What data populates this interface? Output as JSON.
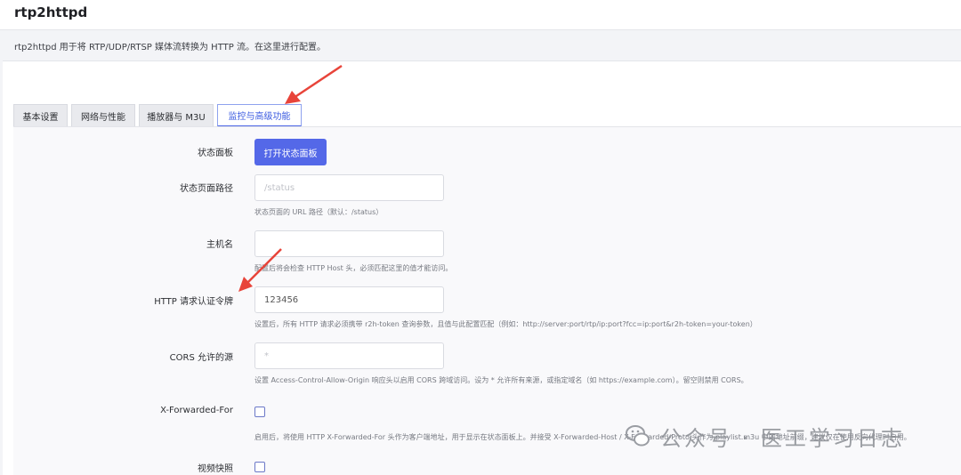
{
  "app": {
    "title": "rtp2httpd",
    "description": "rtp2httpd 用于将 RTP/UDP/RTSP 媒体流转换为 HTTP 流。在这里进行配置。"
  },
  "tabs": [
    {
      "label": "基本设置"
    },
    {
      "label": "网络与性能"
    },
    {
      "label": "播放器与 M3U"
    },
    {
      "label": "监控与高级功能",
      "active": true
    }
  ],
  "form": {
    "status_panel": {
      "label": "状态面板",
      "button": "打开状态面板"
    },
    "status_path": {
      "label": "状态页面路径",
      "placeholder": "/status",
      "help": "状态页面的 URL 路径（默认：/status）"
    },
    "hostname": {
      "label": "主机名",
      "value": "",
      "help": "配置后将会检查 HTTP Host 头，必须匹配这里的值才能访问。"
    },
    "token": {
      "label": "HTTP 请求认证令牌",
      "value": "123456",
      "help": "设置后，所有 HTTP 请求必须携带 r2h-token 查询参数，且值与此配置匹配（例如：http://server:port/rtp/ip:port?fcc=ip:port&r2h-token=your-token）"
    },
    "cors": {
      "label": "CORS 允许的源",
      "placeholder": "*",
      "help": "设置 Access-Control-Allow-Origin 响应头以启用 CORS 跨域访问。设为 * 允许所有来源，或指定域名（如 https://example.com）。留空则禁用 CORS。"
    },
    "xff": {
      "label": "X-Forwarded-For",
      "checked": false,
      "help": "启用后，将使用 HTTP X-Forwarded-For 头作为客户端地址，用于显示在状态面板上。并接受 X-Forwarded-Host / X-Forwarded-Proto 头作为 playlist.m3u 中的地址前缀，建议仅在使用反向代理时启用。"
    },
    "snapshot": {
      "label": "视频快照",
      "checked": false
    }
  },
  "watermark": {
    "text": "公众号 · 医工学习日志",
    "icon": "wechat-icon"
  },
  "colors": {
    "accent": "#5468e8",
    "arrow": "#e8443a"
  }
}
